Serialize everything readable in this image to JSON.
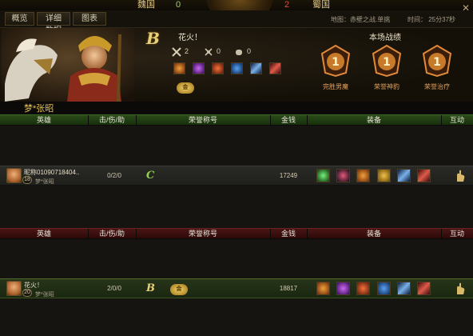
{
  "scoreboard": {
    "left_faction": "魏国",
    "left_score": "0",
    "right_score": "2",
    "right_faction": "蜀国"
  },
  "tabs": [
    "概览",
    "详细数据",
    "图表"
  ],
  "match_info": {
    "map": "地图：赤壁之战.单挑",
    "time": "时间： 25分37秒"
  },
  "hero_panel": {
    "grade": "B",
    "name": "花火！",
    "stats": [
      "2",
      "0",
      "0"
    ],
    "stat_icons": [
      "crossed-swords-icon",
      "skull-icon",
      "fist-icon"
    ],
    "equipment": [
      "flame-armor-icon",
      "purple-crystal-icon",
      "orange-orb-icon",
      "blue-potion-icon",
      "blue-sword-icon",
      "red-blade-icon"
    ],
    "badge": "金"
  },
  "battle_results": {
    "title": "本场战绩",
    "medals": [
      {
        "rank": "1",
        "label": "完胜男魔"
      },
      {
        "rank": "1",
        "label": "荣誉神豹"
      },
      {
        "rank": "1",
        "label": "荣誉治疗"
      }
    ]
  },
  "team_name": "梦*张昭",
  "columns": [
    "英雄",
    "击/伤/助",
    "荣誉称号",
    "金钱",
    "装备",
    "互动"
  ],
  "team_a": [
    {
      "name": "昵称01090718404..",
      "level": "18",
      "team": "梦*张昭",
      "kda": "0/2/0",
      "grade": "C",
      "money": "17249",
      "equipment": [
        "green-energy-icon",
        "dark-gem-icon",
        "flame-helm-icon",
        "gold-shield-icon",
        "blue-sword-icon",
        "red-blade-icon"
      ]
    }
  ],
  "team_b": [
    {
      "name": "花火！",
      "level": "20",
      "team": "梦*张昭",
      "kda": "2/0/0",
      "grade": "B",
      "badge": "金",
      "money": "18817",
      "equipment": [
        "flame-armor-icon",
        "purple-crystal-icon",
        "orange-orb-icon",
        "blue-potion-icon",
        "blue-sword-icon",
        "red-blade-icon"
      ]
    }
  ],
  "colors": {
    "green_header": "#2b4a19",
    "red_header": "#4b1414",
    "gold": "#e2bf53"
  }
}
